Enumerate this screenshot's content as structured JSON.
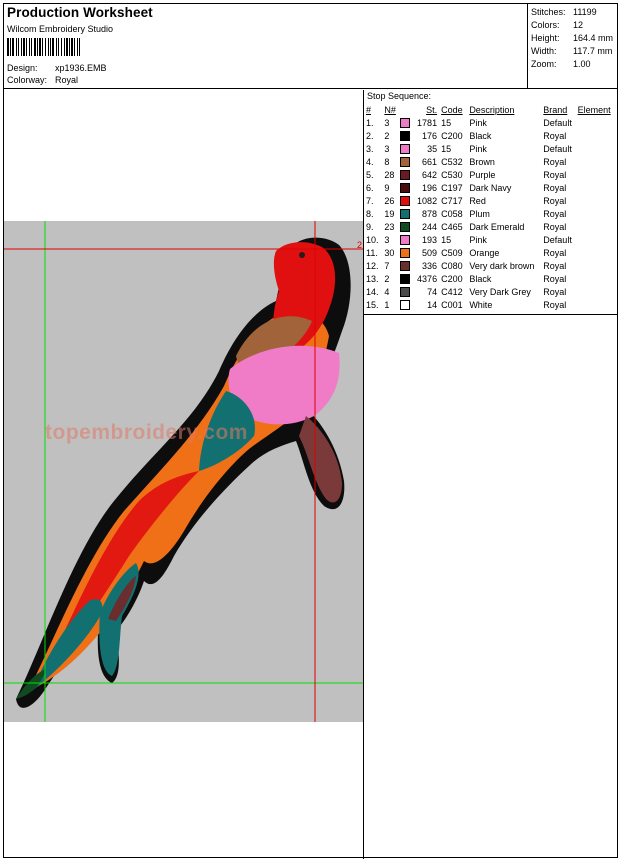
{
  "header": {
    "title": "Production Worksheet",
    "software": "Wilcom Embroidery Studio",
    "design_label": "Design:",
    "design_value": "xp1936.EMB",
    "colorway_label": "Colorway:",
    "colorway_value": "Royal"
  },
  "stats": [
    {
      "label": "Stitches:",
      "value": "11199"
    },
    {
      "label": "Colors:",
      "value": "12"
    },
    {
      "label": "Height:",
      "value": "164.4 mm"
    },
    {
      "label": "Width:",
      "value": "117.7 mm"
    },
    {
      "label": "Zoom:",
      "value": "1.00"
    }
  ],
  "preview": {
    "watermark": "topembroidery.com",
    "marker_label": "2"
  },
  "stop_sequence": {
    "title": "Stop Sequence:",
    "columns": [
      "#",
      "N#",
      "St.",
      "Code",
      "Description",
      "Brand",
      "Element"
    ],
    "rows": [
      {
        "idx": "1.",
        "n": "3",
        "color": "#f07cc8",
        "st": "1781",
        "code": "15",
        "desc": "Pink",
        "brand": "Default",
        "element": ""
      },
      {
        "idx": "2.",
        "n": "2",
        "color": "#000000",
        "st": "176",
        "code": "C200",
        "desc": "Black",
        "brand": "Royal",
        "element": ""
      },
      {
        "idx": "3.",
        "n": "3",
        "color": "#f07cc8",
        "st": "35",
        "code": "15",
        "desc": "Pink",
        "brand": "Default",
        "element": ""
      },
      {
        "idx": "4.",
        "n": "8",
        "color": "#a0633a",
        "st": "661",
        "code": "C532",
        "desc": "Brown",
        "brand": "Royal",
        "element": ""
      },
      {
        "idx": "5.",
        "n": "28",
        "color": "#6a1a22",
        "st": "642",
        "code": "C530",
        "desc": "Purple",
        "brand": "Royal",
        "element": ""
      },
      {
        "idx": "6.",
        "n": "9",
        "color": "#4a0c0c",
        "st": "196",
        "code": "C197",
        "desc": "Dark Navy",
        "brand": "Royal",
        "element": ""
      },
      {
        "idx": "7.",
        "n": "26",
        "color": "#e01010",
        "st": "1082",
        "code": "C717",
        "desc": "Red",
        "brand": "Royal",
        "element": ""
      },
      {
        "idx": "8.",
        "n": "19",
        "color": "#137070",
        "st": "878",
        "code": "C058",
        "desc": "Plum",
        "brand": "Royal",
        "element": ""
      },
      {
        "idx": "9.",
        "n": "23",
        "color": "#104a20",
        "st": "244",
        "code": "C465",
        "desc": "Dark Emerald",
        "brand": "Royal",
        "element": ""
      },
      {
        "idx": "10.",
        "n": "3",
        "color": "#f07cc8",
        "st": "193",
        "code": "15",
        "desc": "Pink",
        "brand": "Default",
        "element": ""
      },
      {
        "idx": "11.",
        "n": "30",
        "color": "#f07018",
        "st": "509",
        "code": "C509",
        "desc": "Orange",
        "brand": "Royal",
        "element": ""
      },
      {
        "idx": "12.",
        "n": "7",
        "color": "#6a2e2e",
        "st": "336",
        "code": "C080",
        "desc": "Very dark brown",
        "brand": "Royal",
        "element": ""
      },
      {
        "idx": "13.",
        "n": "2",
        "color": "#000000",
        "st": "4376",
        "code": "C200",
        "desc": "Black",
        "brand": "Royal",
        "element": ""
      },
      {
        "idx": "14.",
        "n": "4",
        "color": "#4a4a4a",
        "st": "74",
        "code": "C412",
        "desc": "Very Dark Grey",
        "brand": "Royal",
        "element": ""
      },
      {
        "idx": "15.",
        "n": "1",
        "color": "#ffffff",
        "st": "14",
        "code": "C001",
        "desc": "White",
        "brand": "Royal",
        "element": ""
      }
    ]
  }
}
